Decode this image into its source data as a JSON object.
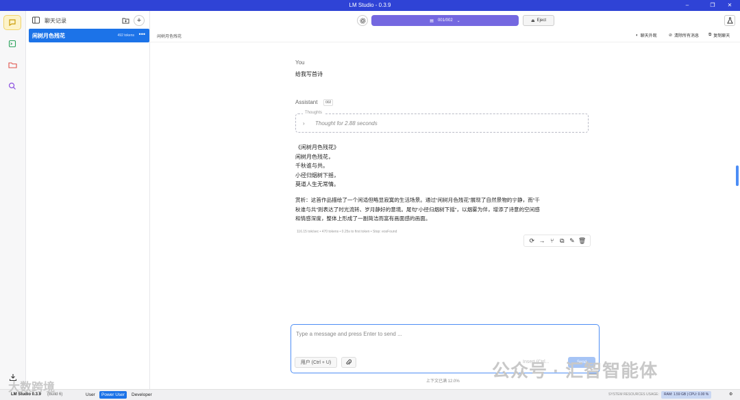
{
  "window": {
    "title": "LM Studio - 0.3.9"
  },
  "colors": {
    "accent": "#2f43d6",
    "model_pill": "#7468e0",
    "selected": "#1c73e8",
    "input_border": "#4c8df5"
  },
  "rail": {
    "items": [
      {
        "icon": "chat-icon",
        "active": true
      },
      {
        "icon": "terminal-icon",
        "active": false
      },
      {
        "icon": "folder-icon",
        "active": false
      },
      {
        "icon": "search-icon",
        "active": false
      }
    ],
    "download_icon": "download-icon"
  },
  "chatlist": {
    "header_label": "聊天记录",
    "items": [
      {
        "name": "闲树月色残花",
        "tokens": "492 tokens"
      }
    ]
  },
  "topbar": {
    "model_label": "001/002",
    "eject_label": "Eject"
  },
  "subbar": {
    "breadcrumb": "闲树月色残花",
    "actions": [
      "聊天外观",
      "清除所有消息",
      "复制聊天"
    ]
  },
  "conversation": {
    "user_role": "You",
    "user_message": "给我写首诗",
    "assistant_role": "Assistant",
    "assistant_badge": "002",
    "thoughts_legend": "Thoughts",
    "thoughts_text": "Thought for 2.88 seconds",
    "poem": [
      "《闲树月色残花》",
      "闲树月色残花，",
      "千秋谁与共。",
      "小径归烟树下摇，",
      "莫道人生无常情。"
    ],
    "analysis": [
      "赏析：这首作品描绘了一个闲适但略显寂寞的生活场景。通过“闲树月色残花”展现了自然景物的宁静，而“千",
      "秋谁与共”则表达了时光流转、岁月静好的意境。尾句“小径归烟树下摇”，以烟雾为伴，增添了诗意的空间感",
      "和情感深度，整体上形成了一副简洁而富有画面感的画面。"
    ],
    "stats": "116.15 tok/sec • 470 tokens • 0.25s to first token • Stop: eosFound"
  },
  "composer": {
    "placeholder": "Type a message and press Enter to send ...",
    "role_button": "用户 (Ctrl + U)",
    "insert_label": "Insert (Ctrl...",
    "send_label": "Send"
  },
  "context_usage": "上下文已满 12.0%",
  "footer": {
    "version": "LM Studio 0.3.9",
    "build": "(Build 6)",
    "modes": [
      "User",
      "Power User",
      "Developer"
    ],
    "active_mode": "Power User",
    "sysres_label": "SYSTEM RESOURCES USAGE:",
    "sysres_value": "RAM: 1.59 GB  |  CPU: 0.00 %"
  },
  "watermark": {
    "right": "公众号 · 汇智智能体",
    "left": "大数跨境"
  }
}
